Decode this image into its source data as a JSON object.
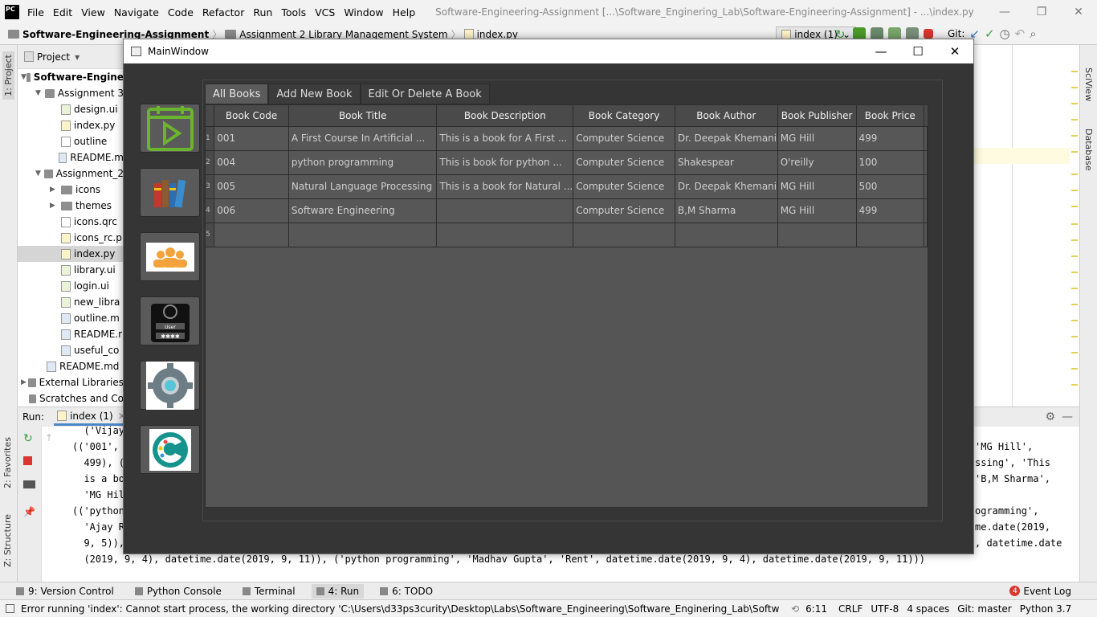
{
  "ide": {
    "logo": "PC",
    "menu": [
      "File",
      "Edit",
      "View",
      "Navigate",
      "Code",
      "Refactor",
      "Run",
      "Tools",
      "VCS",
      "Window",
      "Help"
    ],
    "title": "Software-Engineering-Assignment [...\\Software_Enginering_Lab\\Software-Engineering-Assignment] - ...\\index.py",
    "breadcrumbs": [
      "Software-Engineering-Assignment",
      "Assignment 2 Library Management System",
      "index.py"
    ],
    "run_config": "index (1)",
    "git_label": "Git:"
  },
  "project": {
    "header": "Project",
    "tree": [
      {
        "label": "Software-Engine",
        "type": "folder",
        "depth": 0,
        "arrow": "▼",
        "bold": true
      },
      {
        "label": "Assignment 3",
        "type": "folder",
        "depth": 1,
        "arrow": "▼"
      },
      {
        "label": "design.ui",
        "type": "qt",
        "depth": 2
      },
      {
        "label": "index.py",
        "type": "py",
        "depth": 2
      },
      {
        "label": "outline",
        "type": "file",
        "depth": 2
      },
      {
        "label": "README.m",
        "type": "md",
        "depth": 2
      },
      {
        "label": "Assignment_2",
        "type": "folder",
        "depth": 1,
        "arrow": "▼"
      },
      {
        "label": "icons",
        "type": "folder",
        "depth": 2,
        "arrow": "▶"
      },
      {
        "label": "themes",
        "type": "folder",
        "depth": 2,
        "arrow": "▶"
      },
      {
        "label": "icons.qrc",
        "type": "file",
        "depth": 2
      },
      {
        "label": "icons_rc.p",
        "type": "py",
        "depth": 2
      },
      {
        "label": "index.py",
        "type": "py",
        "depth": 2,
        "selected": true
      },
      {
        "label": "library.ui",
        "type": "qt",
        "depth": 2
      },
      {
        "label": "login.ui",
        "type": "qt",
        "depth": 2
      },
      {
        "label": "new_libra",
        "type": "qt",
        "depth": 2
      },
      {
        "label": "outline.m",
        "type": "md",
        "depth": 2
      },
      {
        "label": "README.r",
        "type": "md",
        "depth": 2
      },
      {
        "label": "useful_co",
        "type": "md",
        "depth": 2
      },
      {
        "label": "README.md",
        "type": "md",
        "depth": 1
      },
      {
        "label": "External Libraries",
        "type": "lib",
        "depth": 0,
        "arrow": "▶"
      },
      {
        "label": "Scratches and Co",
        "type": "scratch",
        "depth": 0
      }
    ]
  },
  "side_tabs": {
    "project": "1: Project",
    "favorites": "2: Favorites",
    "structure": "Z: Structure",
    "sciview": "SciView",
    "database": "Database"
  },
  "run": {
    "label": "Run:",
    "tab": "index (1)",
    "left_lines": [
      "  ('Vijay",
      "(('001',",
      "  499), ('",
      "  is a boo",
      "  'MG Hill",
      "(('python",
      "  'Ajay Ra",
      "  9, 5)),"
    ],
    "right_lines": [
      "'MG Hill',",
      "ssing', 'This",
      "'B,M Sharma',",
      "",
      "ogramming',",
      "me.date(2019,",
      ", datetime.date"
    ],
    "last_line": "  (2019, 9, 4), datetime.date(2019, 9, 11)), ('python programming', 'Madhav Gupta', 'Rent', datetime.date(2019, 9, 4), datetime.date(2019, 9, 11)))"
  },
  "bottom_tabs": [
    {
      "label": "9: Version Control",
      "icon": "vcs-icon"
    },
    {
      "label": "Python Console",
      "icon": "python-console-icon"
    },
    {
      "label": "Terminal",
      "icon": "terminal-icon"
    },
    {
      "label": "4: Run",
      "icon": "run-icon",
      "active": true
    },
    {
      "label": "6: TODO",
      "icon": "todo-icon"
    }
  ],
  "event_log": {
    "count": "4",
    "label": "Event Log"
  },
  "status": {
    "message": "Error running 'index': Cannot start process, the working directory 'C:\\Users\\d33ps3curity\\Desktop\\Labs\\Software_Engineering\\Software_Enginering_Lab\\Software-... (a minute ago)",
    "position": "6:11",
    "line_sep": "CRLF",
    "encoding": "UTF-8",
    "indent": "4 spaces",
    "git": "Git: master",
    "interpreter": "Python 3.7"
  },
  "app": {
    "title": "MainWindow",
    "side_buttons": [
      "today-icon",
      "books-icon",
      "users-icon",
      "user-login-icon",
      "settings-icon",
      "themes-icon"
    ],
    "tabs": [
      "All Books",
      "Add New Book",
      "Edit Or Delete A Book"
    ],
    "columns": [
      "Book Code",
      "Book Title",
      "Book Description",
      "Book Category",
      "Book Author",
      "Book Publisher",
      "Book Price"
    ],
    "row_headers": [
      "1",
      "2",
      "3",
      "4",
      "5"
    ],
    "rows": [
      [
        "001",
        "A First Course In Artificial ...",
        "This is a book for A First ...",
        "Computer Science",
        "Dr. Deepak Khemani",
        "MG Hill",
        "499"
      ],
      [
        "004",
        "python programming",
        "This is book for python ...",
        "Computer Science",
        "Shakespear",
        "O'reilly",
        "100"
      ],
      [
        "005",
        "Natural Language Processing",
        "This is a book for Natural ...",
        "Computer Science",
        "Dr. Deepak Khemani",
        "MG Hill",
        "500"
      ],
      [
        "006",
        "Software Engineering",
        "",
        "Computer Science",
        "B,M Sharma",
        "MG Hill",
        "499"
      ],
      [
        "",
        "",
        "",
        "",
        "",
        "",
        ""
      ]
    ]
  },
  "colors": {
    "window_bg": "#353535",
    "tab_active": "#5b5b5b",
    "table_cell": "#575757",
    "accent_green": "#5aa02c",
    "user_orange": "#f4a23b"
  }
}
